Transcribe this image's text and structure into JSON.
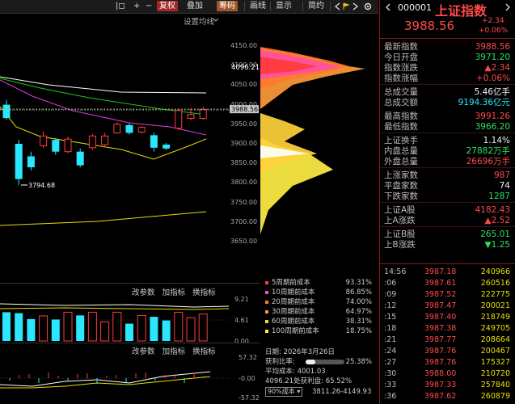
{
  "toolbar": {
    "items": [
      "|◻",
      "+",
      "−",
      "复权",
      "叠加",
      "筹码",
      "画线",
      "显示",
      "简约"
    ],
    "right_icons": [
      "back-arrow",
      "forward-arrow",
      "flag",
      "gear"
    ]
  },
  "chart": {
    "settings_label": "设置均线",
    "price_ticks": [
      "4150.00",
      "4100.00",
      "4050.00",
      "4000.00",
      "3950.00",
      "3900.00",
      "3850.00",
      "3800.00",
      "3750.00",
      "3700.00",
      "3650.00"
    ],
    "hover_value": "4096.21",
    "current_price_tag": "3988.56",
    "low_annotation": "3794.68",
    "candles": [
      {
        "o": 3966,
        "c": 4000,
        "h": 4012,
        "l": 3962,
        "up": false
      },
      {
        "o": 3900,
        "c": 3810,
        "h": 3910,
        "l": 3794.68,
        "up": false
      },
      {
        "o": 3868,
        "c": 3840,
        "h": 3880,
        "l": 3832,
        "up": false
      },
      {
        "o": 3895,
        "c": 3920,
        "h": 3932,
        "l": 3890,
        "up": true
      },
      {
        "o": 3910,
        "c": 3880,
        "h": 3915,
        "l": 3872,
        "up": false
      },
      {
        "o": 3880,
        "c": 3912,
        "h": 3918,
        "l": 3876,
        "up": true
      },
      {
        "o": 3880,
        "c": 3845,
        "h": 3888,
        "l": 3840,
        "up": false
      },
      {
        "o": 3890,
        "c": 3920,
        "h": 3925,
        "l": 3885,
        "up": true
      },
      {
        "o": 3898,
        "c": 3920,
        "h": 3928,
        "l": 3892,
        "up": true
      },
      {
        "o": 3928,
        "c": 3950,
        "h": 3955,
        "l": 3925,
        "up": true
      },
      {
        "o": 3948,
        "c": 3928,
        "h": 3952,
        "l": 3924,
        "up": false
      },
      {
        "o": 3930,
        "c": 3942,
        "h": 3945,
        "l": 3926,
        "up": true
      },
      {
        "o": 3922,
        "c": 3890,
        "h": 3928,
        "l": 3880,
        "up": false
      },
      {
        "o": 3898,
        "c": 3888,
        "h": 3902,
        "l": 3884,
        "up": false
      },
      {
        "o": 3940,
        "c": 3985,
        "h": 3990,
        "l": 3935,
        "up": true
      },
      {
        "o": 3965,
        "c": 3975,
        "h": 3992,
        "l": 3960,
        "up": true
      },
      {
        "o": 3965,
        "c": 3988,
        "h": 3995,
        "l": 3962,
        "up": true
      }
    ],
    "vol_header": [
      "改参数",
      "加指标",
      "换指标"
    ],
    "vol_ticks": [
      "9.21",
      "4.61",
      "0.00"
    ],
    "vol_values": [
      6.3,
      6.1,
      4.8,
      5.5,
      4.7,
      6.3,
      5.6,
      6.3,
      4.2,
      6.3,
      3.8,
      5.6,
      5.3,
      4.5,
      6.3,
      5.1,
      5.9
    ],
    "ind_header": [
      "改参数",
      "加指标",
      "换指标"
    ],
    "ind_ticks": [
      "57.32",
      "-0.00",
      "-57.32"
    ]
  },
  "cost": {
    "rows": [
      {
        "label": "5周期前成本",
        "pct": "93.31%",
        "color": "#ff3b3b"
      },
      {
        "label": "10周期前成本",
        "pct": "86.85%",
        "color": "#ff4fa8"
      },
      {
        "label": "20周期前成本",
        "pct": "74.00%",
        "color": "#ff7a2a"
      },
      {
        "label": "30周期前成本",
        "pct": "64.97%",
        "color": "#ff9a3a"
      },
      {
        "label": "60周期前成本",
        "pct": "38.31%",
        "color": "#ffd23a"
      },
      {
        "label": "100周期前成本",
        "pct": "18.75%",
        "color": "#ffee44"
      }
    ],
    "date": "日期: 2026年3月26日",
    "profit_label": "获利比率:",
    "profit_pct": "25.38%",
    "avg_cost": "平均成本: 4001.03",
    "profit_line": "4096.21处获利盘: 65.52%",
    "range_select": "90%成本",
    "range_value": "3811.26-4149.93"
  },
  "panel": {
    "code": "000001",
    "name": "上证指数",
    "price": "3988.56",
    "change": "+2.34",
    "change_pct": "+0.06%",
    "rows": [
      {
        "label": "最新指数",
        "value": "3988.56",
        "cls": "red"
      },
      {
        "label": "今日开盘",
        "value": "3971.20",
        "cls": "green"
      },
      {
        "label": "指数涨跌",
        "value": "▲2.34",
        "cls": "red"
      },
      {
        "label": "指数涨幅",
        "value": "+0.06%",
        "cls": "red"
      },
      {
        "label": "总成交量",
        "value": "5.46亿手",
        "cls": "white"
      },
      {
        "label": "总成交额",
        "value": "9194.36亿元",
        "cls": "cyan"
      },
      {
        "label": "最高指数",
        "value": "3991.26",
        "cls": "red"
      },
      {
        "label": "最低指数",
        "value": "3966.20",
        "cls": "green"
      },
      {
        "label": "上证换手",
        "value": "1.14%",
        "cls": "white"
      },
      {
        "label": "内盘总量",
        "value": "27882万手",
        "cls": "green"
      },
      {
        "label": "外盘总量",
        "value": "26696万手",
        "cls": "red"
      },
      {
        "label": "上涨家数",
        "value": "987",
        "cls": "red"
      },
      {
        "label": "平盘家数",
        "value": "74",
        "cls": "white"
      },
      {
        "label": "下跌家数",
        "value": "1287",
        "cls": "green"
      },
      {
        "label": "上证A股",
        "value": "4182.43",
        "cls": "red"
      },
      {
        "label": "上A涨跌",
        "value": "▲2.52",
        "cls": "red"
      },
      {
        "label": "上证B股",
        "value": "265.01",
        "cls": "green"
      },
      {
        "label": "上B涨跌",
        "value": "▼1.25",
        "cls": "green"
      }
    ],
    "ticks": [
      {
        "t": "14:56",
        "p": "3987.18",
        "v": "240966"
      },
      {
        "t": ":06",
        "p": "3987.61",
        "v": "260516"
      },
      {
        "t": ":09",
        "p": "3987.52",
        "v": "222775"
      },
      {
        "t": ":12",
        "p": "3987.47",
        "v": "200021"
      },
      {
        "t": ":15",
        "p": "3987.40",
        "v": "218749"
      },
      {
        "t": ":18",
        "p": "3987.38",
        "v": "249705"
      },
      {
        "t": ":21",
        "p": "3987.77",
        "v": "208664"
      },
      {
        "t": ":24",
        "p": "3987.76",
        "v": "200467"
      },
      {
        "t": ":27",
        "p": "3987.76",
        "v": "175327"
      },
      {
        "t": ":30",
        "p": "3988.00",
        "v": "210720"
      },
      {
        "t": ":33",
        "p": "3987.33",
        "v": "257840"
      },
      {
        "t": ":36",
        "p": "3987.62",
        "v": "260879"
      }
    ]
  }
}
